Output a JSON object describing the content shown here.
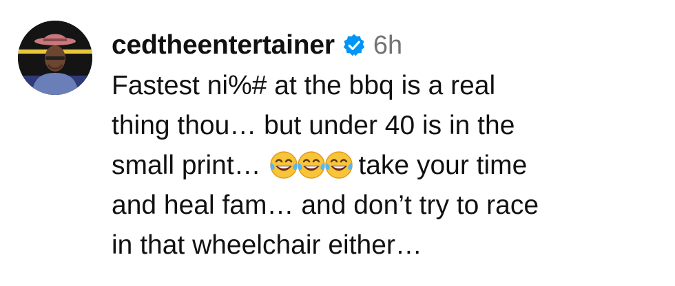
{
  "comment": {
    "username": "cedtheentertainer",
    "timestamp": "6h",
    "avatar_icon": "profile-photo-icon",
    "verified_icon": "verified-badge-icon",
    "verified_color": "#0095F6",
    "text_lines": {
      "line1": "Fastest ni%# at the bbq is a real",
      "line2": "thing thou… but under 40 is in the",
      "line3_before": "small print…",
      "line3_after": "take your time",
      "line4": "and heal fam… and don’t try to race",
      "line5": "in that wheelchair either…"
    },
    "emoji": {
      "name": "face-with-tears-of-joy-icon",
      "count": 3,
      "glyph": "😂😂😂"
    }
  }
}
